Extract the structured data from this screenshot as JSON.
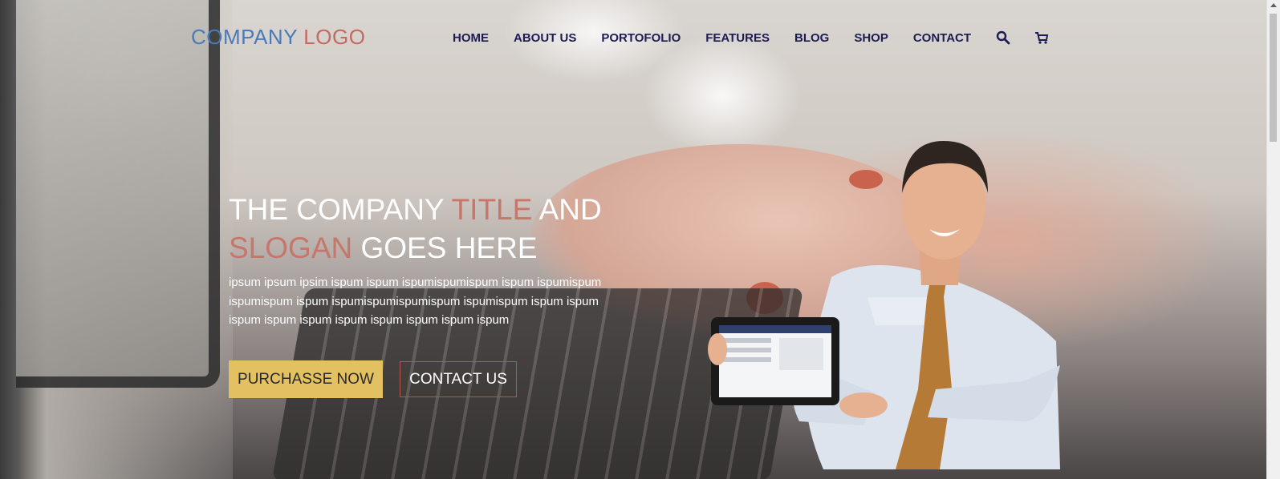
{
  "logo": {
    "part1": "COMPANY",
    "part2": "LOGO"
  },
  "nav": {
    "items": [
      "HOME",
      "ABOUT US",
      "PORTOFOLIO",
      "FEATURES",
      "BLOG",
      "SHOP",
      "CONTACT"
    ],
    "icons": [
      "search-icon",
      "cart-icon"
    ]
  },
  "hero": {
    "title_w1": "THE COMPANY",
    "title_hl1": "TITLE",
    "title_w2": "AND",
    "title_hl2": "SLOGAN",
    "title_w3": "GOES HERE",
    "body": "ipsum ipsum ipsim ispum ispum ispumispumispum ispum ispumispum ispumispum ispum ispumispumispumispum ispumispum ispum ispum ispum ispum ispum ispum ispum ispum ispum ispum",
    "purchase_label": "PURCHASSE NOW",
    "contact_label": "CONTACT US"
  },
  "colors": {
    "logo_blue": "#4a7ab8",
    "logo_red": "#c16a62",
    "nav_text": "#1c1c52",
    "highlight": "#c7766b",
    "button_gold": "#e3c061",
    "button_border": "#b4574c"
  }
}
